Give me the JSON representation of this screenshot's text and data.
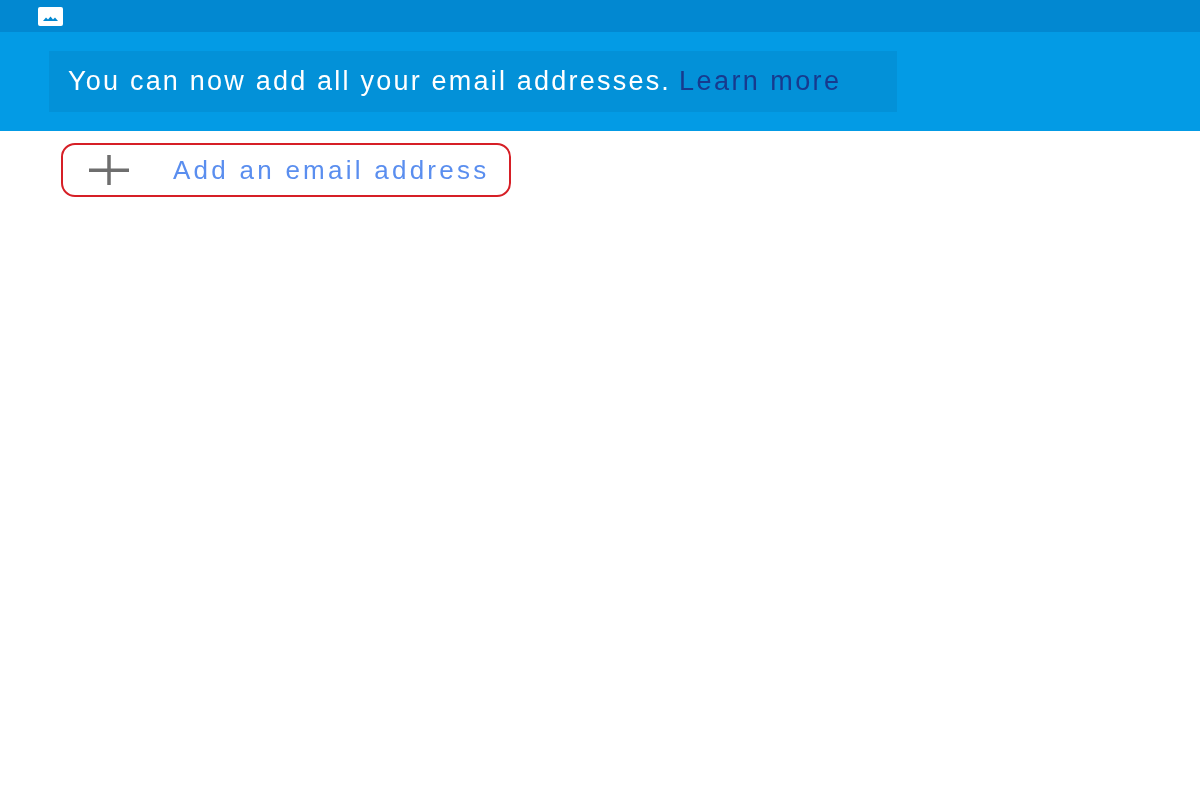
{
  "banner": {
    "message": "You can now add all your email addresses.",
    "link": "Learn more"
  },
  "add_button": {
    "label": "Add an email address",
    "highlighted": true
  }
}
